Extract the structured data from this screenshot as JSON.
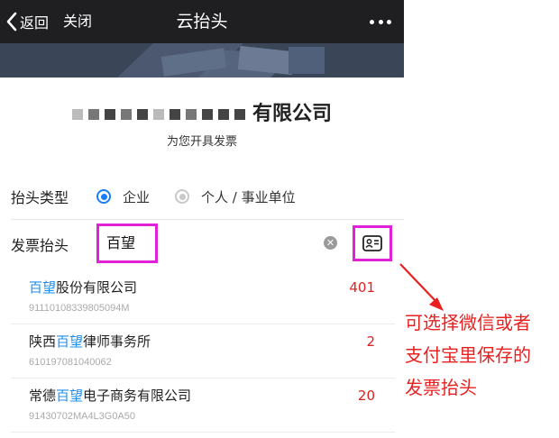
{
  "navbar": {
    "back_label": "返回",
    "close_label": "关闭",
    "title": "云抬头",
    "more_icon": "more-dots-icon"
  },
  "header": {
    "company_name_suffix": "有限公司",
    "subtitle": "为您开具发票"
  },
  "form": {
    "type_label": "抬头类型",
    "type_options": [
      {
        "label": "企业",
        "selected": true
      },
      {
        "label": "个人 / 事业单位",
        "selected": false
      }
    ],
    "title_label": "发票抬头",
    "title_value": "百望",
    "clear_icon": "clear-icon",
    "card_icon": "card-icon"
  },
  "suggestions": [
    {
      "prefix": "",
      "highlight": "百望",
      "suffix": "股份有限公司",
      "code": "91110108339805094M",
      "count": "401"
    },
    {
      "prefix": "陕西",
      "highlight": "百望",
      "suffix": "律师事务所",
      "code": "610197081040062",
      "count": "2"
    },
    {
      "prefix": "常德",
      "highlight": "百望",
      "suffix": "电子商务有限公司",
      "code": "91430702MA4L3G0A50",
      "count": "20"
    }
  ],
  "annotation": {
    "lines": [
      "可选择微信或者",
      "支付宝里保存的",
      "发票抬头"
    ]
  },
  "colors": {
    "accent": "#1b7cf7",
    "highlight": "#1b8ff0",
    "annotation": "#e82020",
    "box": "#e021d8"
  }
}
